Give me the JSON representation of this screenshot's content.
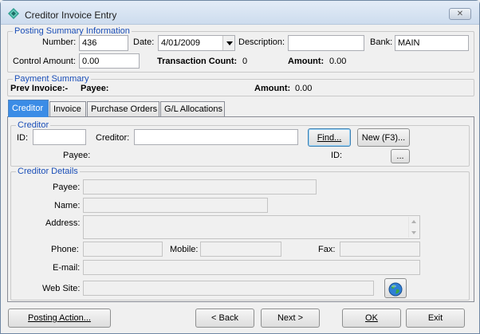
{
  "window": {
    "title": "Creditor Invoice Entry",
    "close_glyph": "✕"
  },
  "posting_summary": {
    "legend": "Posting Summary Information",
    "number_label": "Number:",
    "number_value": "436",
    "date_label": "Date:",
    "date_value": "4/01/2009",
    "description_label": "Description:",
    "description_value": "",
    "bank_label": "Bank:",
    "bank_value": "MAIN",
    "control_amount_label": "Control Amount:",
    "control_amount_value": "0.00",
    "transaction_count_label": "Transaction Count:",
    "transaction_count_value": "0",
    "amount_label": "Amount:",
    "amount_value": "0.00"
  },
  "payment_summary": {
    "legend": "Payment Summary",
    "prev_invoice_label": "Prev Invoice:-",
    "payee_label": "Payee:",
    "amount_label": "Amount:",
    "amount_value": "0.00"
  },
  "tabs": [
    {
      "label": "Creditor",
      "active": true
    },
    {
      "label": "Invoice",
      "active": false
    },
    {
      "label": "Purchase Orders",
      "active": false
    },
    {
      "label": "G/L Allocations",
      "active": false
    }
  ],
  "creditor": {
    "legend": "Creditor",
    "id_label": "ID:",
    "id_value": "",
    "creditor_label": "Creditor:",
    "creditor_value": "",
    "find_button": "Find...",
    "new_button": "New (F3)...",
    "payee_label": "Payee:",
    "payee_id_label": "ID:",
    "ellipsis_button": "..."
  },
  "creditor_details": {
    "legend": "Creditor Details",
    "payee_label": "Payee:",
    "name_label": "Name:",
    "address_label": "Address:",
    "phone_label": "Phone:",
    "mobile_label": "Mobile:",
    "fax_label": "Fax:",
    "email_label": "E-mail:",
    "website_label": "Web Site:"
  },
  "footer": {
    "posting_action": "Posting Action...",
    "back": "< Back",
    "next": "Next >",
    "ok": "OK",
    "exit": "Exit"
  },
  "icons": {
    "app_icon": "diamond-app-icon",
    "globe_icon": "globe-icon"
  },
  "colors": {
    "legend_text": "#1b4fb8",
    "active_tab": "#3b8ce6"
  }
}
